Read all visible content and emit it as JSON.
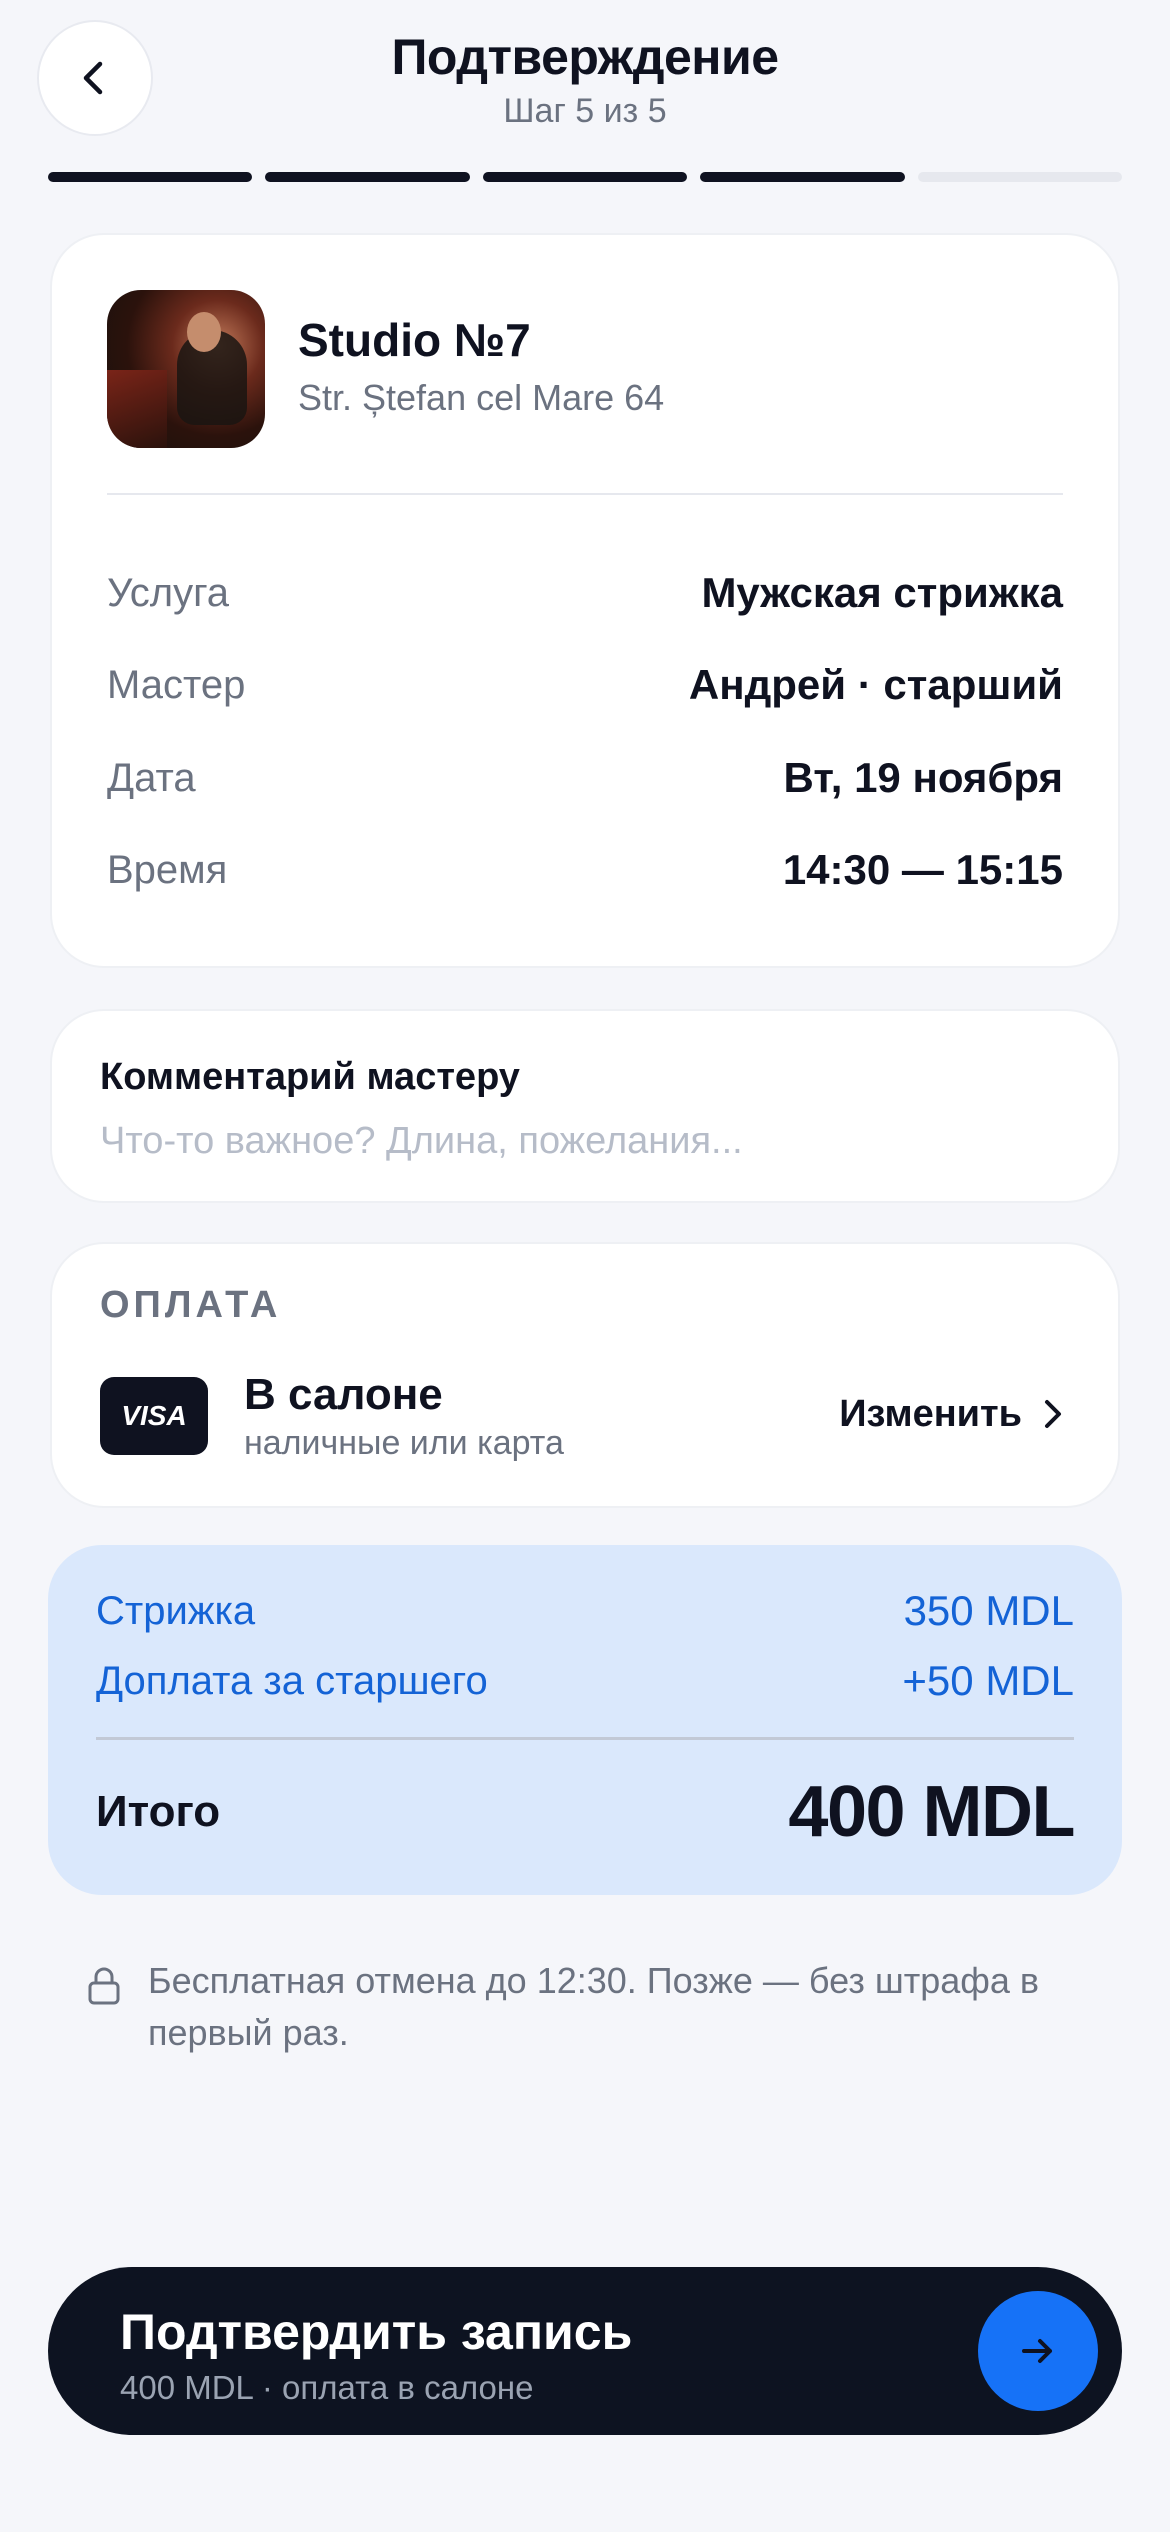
{
  "header": {
    "title": "Подтверждение",
    "step": "Шаг 5 из 5"
  },
  "progress": {
    "total_steps": 5,
    "completed_steps": 4
  },
  "salon": {
    "name": "Studio №7",
    "address": "Str. Ștefan cel Mare 64"
  },
  "details": [
    {
      "label": "Услуга",
      "value": "Мужская стрижка"
    },
    {
      "label": "Мастер",
      "value": "Андрей · старший"
    },
    {
      "label": "Дата",
      "value": "Вт, 19 ноября"
    },
    {
      "label": "Время",
      "value": "14:30 — 15:15"
    }
  ],
  "comment": {
    "label": "Комментарий мастеру",
    "placeholder": "Что-то важное? Длина, пожелания...",
    "value": ""
  },
  "payment": {
    "title": "ОПЛАТА",
    "badge": "VISA",
    "method": "В салоне",
    "sub": "наличные или карта",
    "change_label": "Изменить"
  },
  "summary": {
    "lines": [
      {
        "label": "Стрижка",
        "amount": "350 MDL"
      },
      {
        "label": "Доплата за старшего",
        "amount": "+50 MDL"
      }
    ],
    "total_label": "Итого",
    "total_value": "400 MDL"
  },
  "note": "Бесплатная отмена до 12:30. Позже — без штрафа в первый раз.",
  "cta": {
    "title": "Подтвердить запись",
    "sub": "400 MDL · оплата в салоне"
  },
  "colors": {
    "accent": "#1672f7",
    "summary_bg": "#dae8fc",
    "summary_text": "#1463d6",
    "dark": "#0f1220"
  },
  "icons": {
    "back": "chevron-left-icon",
    "change": "chevron-right-icon",
    "note": "lock-icon",
    "cta": "arrow-right-icon"
  }
}
